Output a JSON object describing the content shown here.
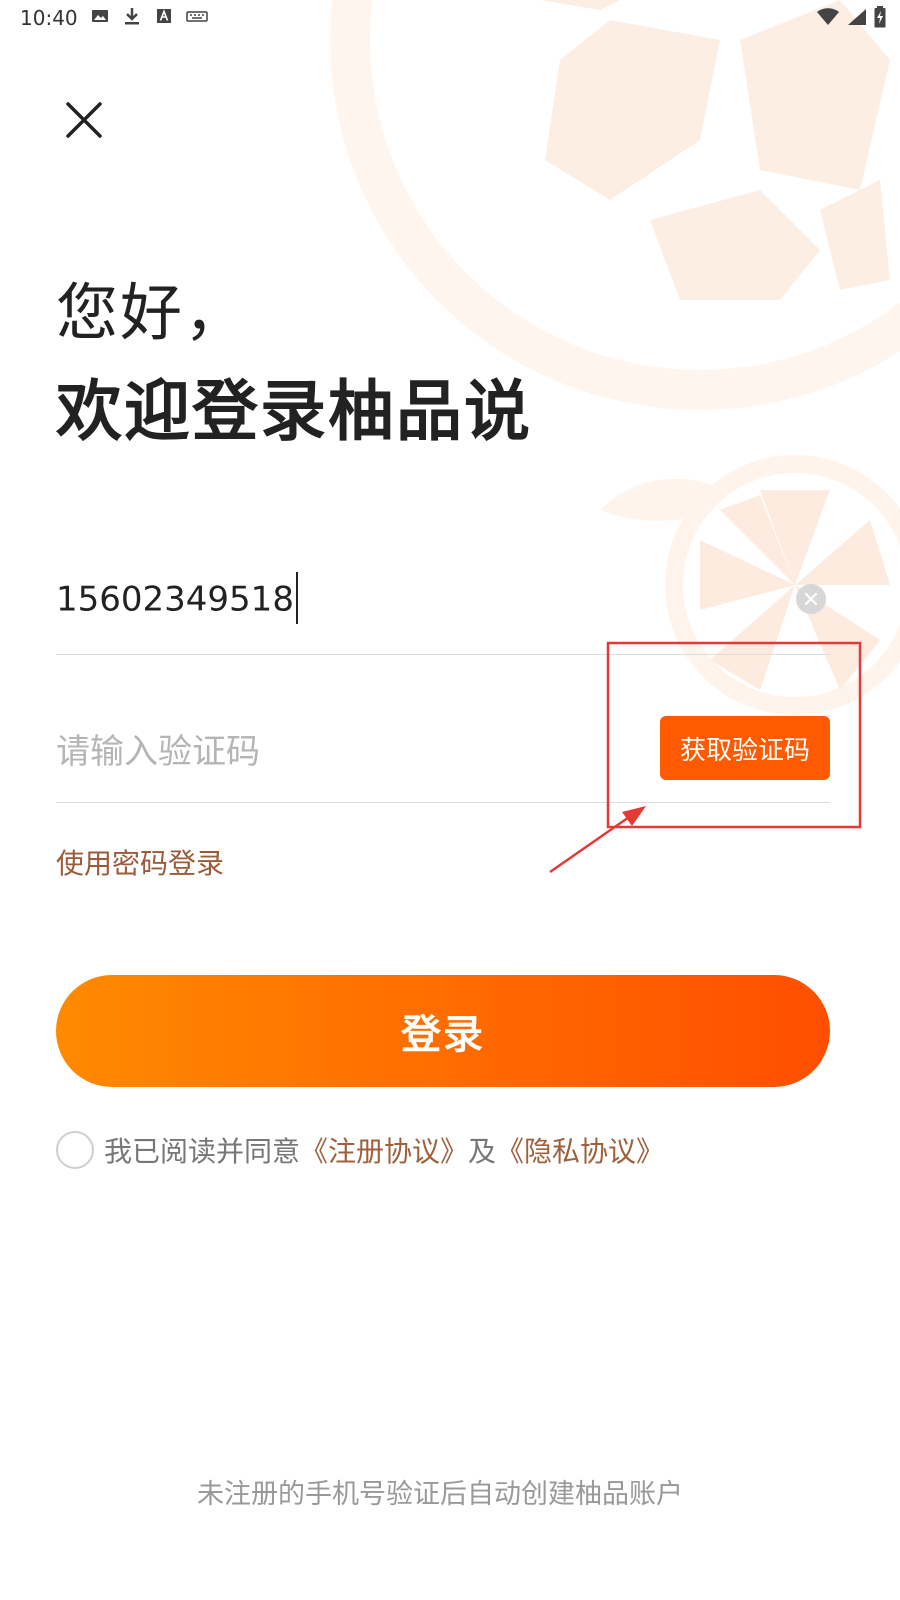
{
  "status_bar": {
    "time": "10:40"
  },
  "close_icon": "close-icon",
  "greeting": "您好，",
  "welcome": "欢迎登录柚品说",
  "phone": {
    "value": "15602349518",
    "clear_icon": "clear-circle-icon"
  },
  "code": {
    "placeholder": "请输入验证码",
    "button_label": "获取验证码"
  },
  "password_login": "使用密码登录",
  "login_button": "登录",
  "agreement": {
    "prefix": "我已阅读并同意",
    "register_link": "《注册协议》",
    "and": "及",
    "privacy_link": "《隐私协议》"
  },
  "footer_note": "未注册的手机号验证后自动创建柚品账户",
  "colors": {
    "accent": "#ff5a00",
    "gradient_start": "#ff8a00",
    "gradient_end": "#ff4e00",
    "link": "#a0603d",
    "annotation": "#e53935"
  }
}
